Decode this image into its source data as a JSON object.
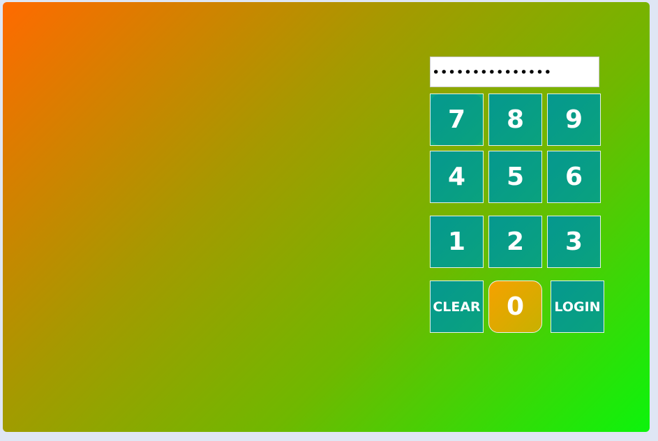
{
  "pin_display": {
    "value": "•••••••••••••••"
  },
  "keypad": {
    "k7": "7",
    "k8": "8",
    "k9": "9",
    "k4": "4",
    "k5": "5",
    "k6": "6",
    "k1": "1",
    "k2": "2",
    "k3": "3",
    "clear": "CLEAR",
    "k0": "0",
    "login": "LOGIN"
  },
  "colors": {
    "gradient_start": "#ff6a00",
    "gradient_end": "#0cf40c",
    "key_color": "#05988f",
    "active_key_color": "#f6a100"
  }
}
